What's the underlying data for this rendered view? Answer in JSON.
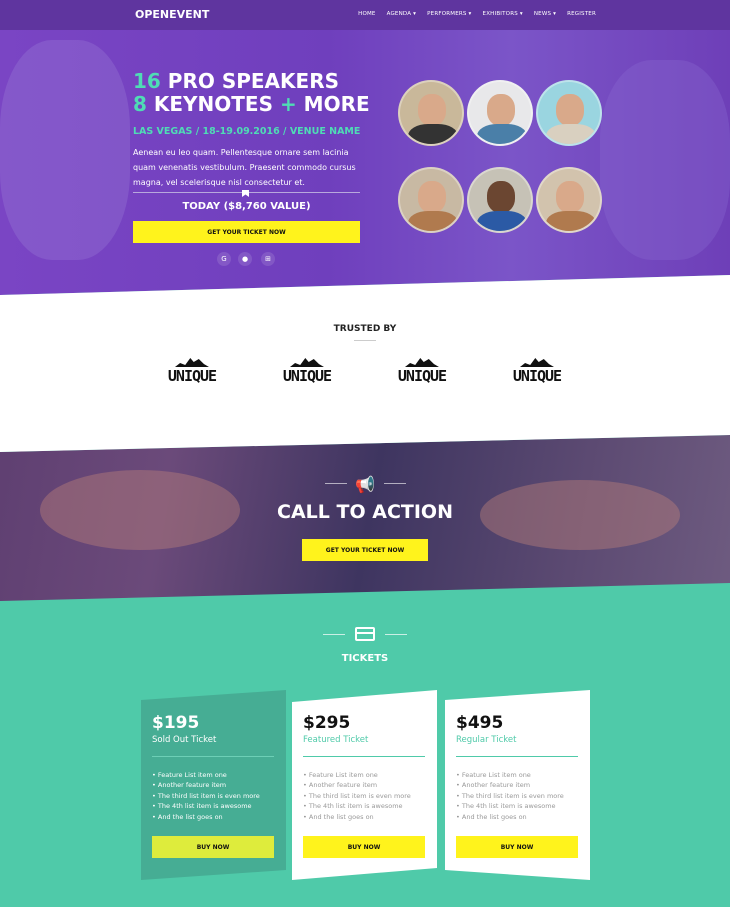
{
  "nav": {
    "logo": "OPENEVENT",
    "items": [
      {
        "label": "HOME"
      },
      {
        "label": "AGENDA ▾"
      },
      {
        "label": "PERFORMERS ▾"
      },
      {
        "label": "EXHIBITORS ▾"
      },
      {
        "label": "NEWS ▾"
      },
      {
        "label": "REGISTER"
      }
    ]
  },
  "hero": {
    "line1_num": "16",
    "line1_text": " PRO SPEAKERS",
    "line2_num": "8",
    "line2_text": " KEYNOTES ",
    "line2_plus": "+",
    "line2_more": " MORE",
    "venue": "LAS VEGAS / 18-19.09.2016 / VENUE NAME",
    "description": "Aenean eu leo quam. Pellentesque ornare sem lacinia quam venenatis vestibulum. Praesent commodo cursus magna, vel scelerisque nisl consectetur et.",
    "today": "TODAY ($8,760 VALUE)",
    "cta": "GET YOUR TICKET NOW",
    "stores": [
      {
        "icon": "google-icon",
        "glyph": "G"
      },
      {
        "icon": "apple-icon",
        "glyph": "●"
      },
      {
        "icon": "windows-icon",
        "glyph": "⊞"
      }
    ]
  },
  "trusted": {
    "title": "TRUSTED BY",
    "logos": [
      "UNIQUE",
      "UNIQUE",
      "UNIQUE",
      "UNIQUE"
    ]
  },
  "cta": {
    "icon": "megaphone-icon",
    "glyph": "📢",
    "title": "CALL TO ACTION",
    "button": "GET YOUR TICKET NOW"
  },
  "tickets": {
    "icon": "ticket-icon",
    "title": "TICKETS",
    "cards": [
      {
        "price": "$195",
        "type": "Sold Out Ticket",
        "features": [
          "Feature List item one",
          "Another feature item",
          "The third list item is even more",
          "The 4th list item is awesome",
          "And the list goes on"
        ],
        "button": "BUY NOW"
      },
      {
        "price": "$295",
        "type": "Featured Ticket",
        "features": [
          "Feature List item one",
          "Another feature item",
          "The third list item is even more",
          "The 4th list item is awesome",
          "And the list goes on"
        ],
        "button": "BUY NOW"
      },
      {
        "price": "$495",
        "type": "Regular Ticket",
        "features": [
          "Feature List item one",
          "Another feature item",
          "The third list item is even more",
          "The 4th list item is awesome",
          "And the list goes on"
        ],
        "button": "BUY NOW"
      }
    ]
  },
  "colors": {
    "purple": "#6f3fbd",
    "teal": "#4fcaa9",
    "yellow": "#fff31c"
  }
}
